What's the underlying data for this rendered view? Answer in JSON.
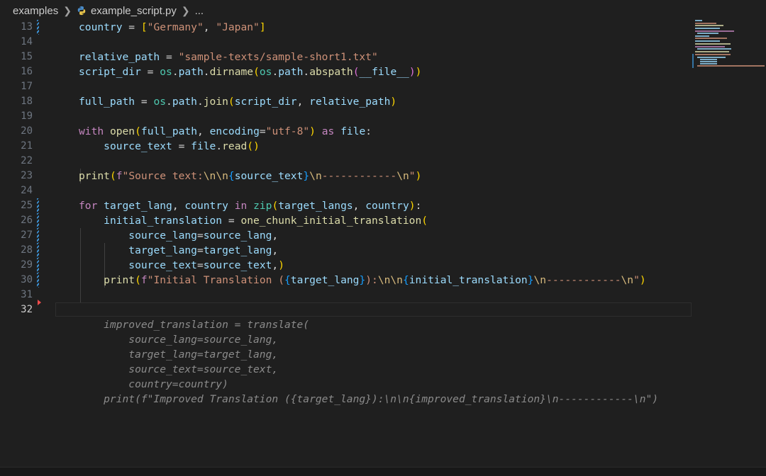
{
  "breadcrumb": {
    "folder": "examples",
    "file": "example_script.py",
    "more": "..."
  },
  "editor": {
    "active_line": "32",
    "lines": [
      {
        "num": "13",
        "tokens": [
          {
            "t": "country",
            "c": "v"
          },
          {
            "t": " = "
          },
          {
            "t": "[",
            "c": "b1"
          },
          {
            "t": "\"Germany\"",
            "c": "s"
          },
          {
            "t": ", "
          },
          {
            "t": "\"Japan\"",
            "c": "s"
          },
          {
            "t": "]",
            "c": "b1"
          }
        ]
      },
      {
        "num": "14",
        "tokens": []
      },
      {
        "num": "15",
        "tokens": [
          {
            "t": "relative_path",
            "c": "v"
          },
          {
            "t": " = "
          },
          {
            "t": "\"sample-texts/sample-short1.txt\"",
            "c": "s"
          }
        ]
      },
      {
        "num": "16",
        "tokens": [
          {
            "t": "script_dir",
            "c": "v"
          },
          {
            "t": " = "
          },
          {
            "t": "os",
            "c": "t"
          },
          {
            "t": "."
          },
          {
            "t": "path",
            "c": "v"
          },
          {
            "t": "."
          },
          {
            "t": "dirname",
            "c": "f"
          },
          {
            "t": "(",
            "c": "b1"
          },
          {
            "t": "os",
            "c": "t"
          },
          {
            "t": "."
          },
          {
            "t": "path",
            "c": "v"
          },
          {
            "t": "."
          },
          {
            "t": "abspath",
            "c": "f"
          },
          {
            "t": "(",
            "c": "b2"
          },
          {
            "t": "__file__",
            "c": "v"
          },
          {
            "t": ")",
            "c": "b2"
          },
          {
            "t": ")",
            "c": "b1"
          }
        ]
      },
      {
        "num": "17",
        "tokens": []
      },
      {
        "num": "18",
        "tokens": [
          {
            "t": "full_path",
            "c": "v"
          },
          {
            "t": " = "
          },
          {
            "t": "os",
            "c": "t"
          },
          {
            "t": "."
          },
          {
            "t": "path",
            "c": "v"
          },
          {
            "t": "."
          },
          {
            "t": "join",
            "c": "f"
          },
          {
            "t": "(",
            "c": "b1"
          },
          {
            "t": "script_dir",
            "c": "v"
          },
          {
            "t": ", "
          },
          {
            "t": "relative_path",
            "c": "v"
          },
          {
            "t": ")",
            "c": "b1"
          }
        ]
      },
      {
        "num": "19",
        "tokens": []
      },
      {
        "num": "20",
        "tokens": [
          {
            "t": "with",
            "c": "k"
          },
          {
            "t": " "
          },
          {
            "t": "open",
            "c": "f"
          },
          {
            "t": "(",
            "c": "b1"
          },
          {
            "t": "full_path",
            "c": "v"
          },
          {
            "t": ", "
          },
          {
            "t": "encoding",
            "c": "v"
          },
          {
            "t": "="
          },
          {
            "t": "\"utf-8\"",
            "c": "s"
          },
          {
            "t": ")",
            "c": "b1"
          },
          {
            "t": " "
          },
          {
            "t": "as",
            "c": "k"
          },
          {
            "t": " "
          },
          {
            "t": "file",
            "c": "v"
          },
          {
            "t": ":"
          }
        ]
      },
      {
        "num": "21",
        "tokens": [
          {
            "t": "    "
          },
          {
            "t": "source_text",
            "c": "v"
          },
          {
            "t": " = "
          },
          {
            "t": "file",
            "c": "v"
          },
          {
            "t": "."
          },
          {
            "t": "read",
            "c": "f"
          },
          {
            "t": "()",
            "c": "b1"
          }
        ]
      },
      {
        "num": "22",
        "tokens": []
      },
      {
        "num": "23",
        "tokens": [
          {
            "t": "print",
            "c": "f"
          },
          {
            "t": "(",
            "c": "b1"
          },
          {
            "t": "f",
            "c": "k"
          },
          {
            "t": "\"Source text:",
            "c": "s"
          },
          {
            "t": "\\n\\n",
            "c": "e"
          },
          {
            "t": "{",
            "c": "b3"
          },
          {
            "t": "source_text",
            "c": "v"
          },
          {
            "t": "}",
            "c": "b3"
          },
          {
            "t": "\\n",
            "c": "e"
          },
          {
            "t": "------------",
            "c": "s"
          },
          {
            "t": "\\n",
            "c": "e"
          },
          {
            "t": "\"",
            "c": "s"
          },
          {
            "t": ")",
            "c": "b1"
          }
        ]
      },
      {
        "num": "24",
        "tokens": []
      },
      {
        "num": "25",
        "tokens": [
          {
            "t": "for",
            "c": "k"
          },
          {
            "t": " "
          },
          {
            "t": "target_lang",
            "c": "v"
          },
          {
            "t": ", "
          },
          {
            "t": "country",
            "c": "v"
          },
          {
            "t": " "
          },
          {
            "t": "in",
            "c": "k"
          },
          {
            "t": " "
          },
          {
            "t": "zip",
            "c": "t"
          },
          {
            "t": "(",
            "c": "b1"
          },
          {
            "t": "target_langs",
            "c": "v"
          },
          {
            "t": ", "
          },
          {
            "t": "country",
            "c": "v"
          },
          {
            "t": ")",
            "c": "b1"
          },
          {
            "t": ":"
          }
        ]
      },
      {
        "num": "26",
        "tokens": [
          {
            "t": "    "
          },
          {
            "t": "initial_translation",
            "c": "v"
          },
          {
            "t": " = "
          },
          {
            "t": "one_chunk_initial_translation",
            "c": "f"
          },
          {
            "t": "(",
            "c": "b1"
          }
        ]
      },
      {
        "num": "27",
        "tokens": [
          {
            "t": "        "
          },
          {
            "t": "source_lang",
            "c": "v"
          },
          {
            "t": "="
          },
          {
            "t": "source_lang",
            "c": "v"
          },
          {
            "t": ","
          }
        ]
      },
      {
        "num": "28",
        "tokens": [
          {
            "t": "        "
          },
          {
            "t": "target_lang",
            "c": "v"
          },
          {
            "t": "="
          },
          {
            "t": "target_lang",
            "c": "v"
          },
          {
            "t": ","
          }
        ]
      },
      {
        "num": "29",
        "tokens": [
          {
            "t": "        "
          },
          {
            "t": "source_text",
            "c": "v"
          },
          {
            "t": "="
          },
          {
            "t": "source_text",
            "c": "v"
          },
          {
            "t": ","
          },
          {
            "t": ")",
            "c": "b1"
          }
        ]
      },
      {
        "num": "30",
        "tokens": [
          {
            "t": "    "
          },
          {
            "t": "print",
            "c": "f"
          },
          {
            "t": "(",
            "c": "b1"
          },
          {
            "t": "f",
            "c": "k"
          },
          {
            "t": "\"Initial Translation (",
            "c": "s"
          },
          {
            "t": "{",
            "c": "b3"
          },
          {
            "t": "target_lang",
            "c": "v"
          },
          {
            "t": "}",
            "c": "b3"
          },
          {
            "t": "):",
            "c": "s"
          },
          {
            "t": "\\n\\n",
            "c": "e"
          },
          {
            "t": "{",
            "c": "b3"
          },
          {
            "t": "initial_translation",
            "c": "v"
          },
          {
            "t": "}",
            "c": "b3"
          },
          {
            "t": "\\n",
            "c": "e"
          },
          {
            "t": "------------",
            "c": "s"
          },
          {
            "t": "\\n",
            "c": "e"
          },
          {
            "t": "\"",
            "c": "s"
          },
          {
            "t": ")",
            "c": "b1"
          }
        ]
      },
      {
        "num": "31",
        "tokens": []
      },
      {
        "num": "32",
        "tokens": []
      }
    ],
    "suggestion": [
      "    improved_translation = translate(",
      "        source_lang=source_lang,",
      "        target_lang=target_lang,",
      "        source_text=source_text,",
      "        country=country)",
      "    print(f\"Improved Translation ({target_lang}):\\n\\n{improved_translation}\\n------------\\n\")"
    ]
  },
  "icons": {
    "file_icon": "python-icon",
    "separator_icon": "chevron-right-icon"
  },
  "colors": {
    "background": "#1f1f1f",
    "keyword": "#c586c0",
    "string": "#ce9178",
    "function": "#dcdcaa",
    "variable": "#9cdcfe",
    "ghost_text": "#8b8b8b"
  }
}
